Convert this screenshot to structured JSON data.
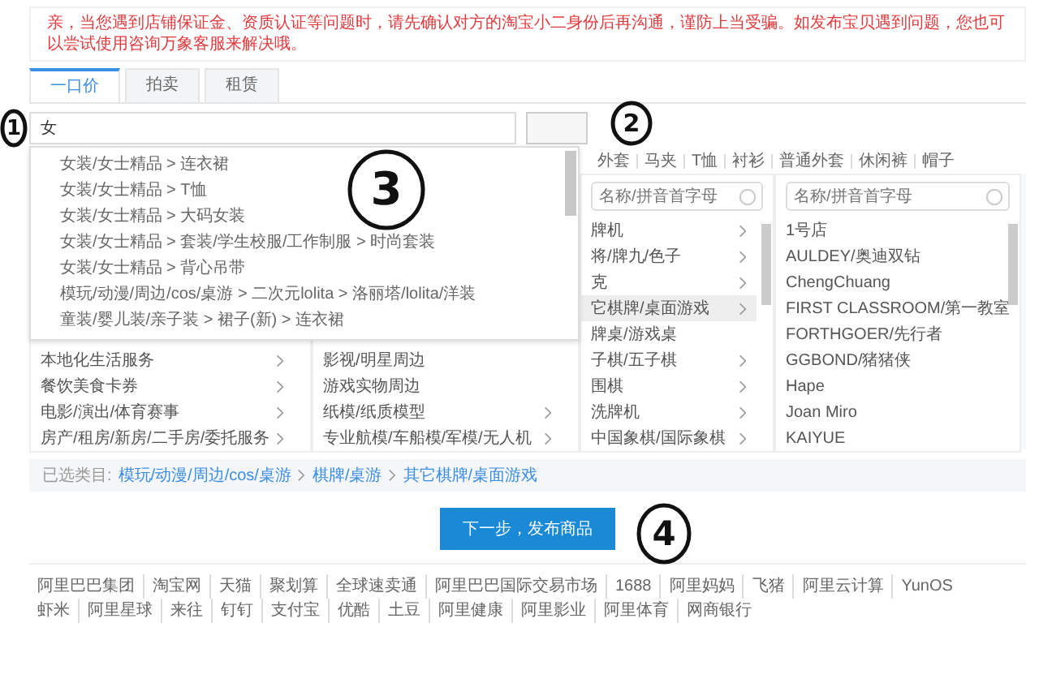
{
  "notice": "亲，当您遇到店铺保证金、资质认证等问题时，请先确认对方的淘宝小二身份后再沟通，谨防上当受骗。如发布宝贝遇到问题，您也可以尝试使用咨询万象客服来解决哦。",
  "tabs": [
    {
      "label": "一口价",
      "selected": true
    },
    {
      "label": "拍卖",
      "selected": false
    },
    {
      "label": "租赁",
      "selected": false
    }
  ],
  "search": {
    "value": "女"
  },
  "quick_links": [
    "外套",
    "马夹",
    "T恤",
    "衬衫",
    "普通外套",
    "休闲裤",
    "帽子"
  ],
  "suggestions": [
    "女装/女士精品 > 连衣裙",
    "女装/女士精品 > T恤",
    "女装/女士精品 > 大码女装",
    "女装/女士精品 > 套装/学生校服/工作制服 > 时尚套装",
    "女装/女士精品 > 背心吊带",
    "模玩/动漫/周边/cos/桌游 > 二次元lolita > 洛丽塔/lolita/洋装",
    "童装/婴儿装/亲子装 > 裙子(新) > 连衣裙"
  ],
  "columns": [
    {
      "items": [
        {
          "label": "本地化生活服务",
          "arrow": true,
          "selected": false
        },
        {
          "label": "餐饮美食卡券",
          "arrow": true,
          "selected": false
        },
        {
          "label": "电影/演出/体育赛事",
          "arrow": true,
          "selected": false
        },
        {
          "label": "房产/租房/新房/二手房/委托服务",
          "arrow": true,
          "selected": false
        }
      ]
    },
    {
      "items": [
        {
          "label": "影视/明星周边",
          "arrow": false,
          "selected": false
        },
        {
          "label": "游戏实物周边",
          "arrow": false,
          "selected": false
        },
        {
          "label": "纸模/纸质模型",
          "arrow": true,
          "selected": false
        },
        {
          "label": "专业航模/车船模/军模/无人机",
          "arrow": true,
          "selected": false
        }
      ]
    },
    {
      "placeholder": "名称/拼音首字母",
      "items": [
        {
          "label": "牌机",
          "arrow": true,
          "selected": false
        },
        {
          "label": "将/牌九/色子",
          "arrow": true,
          "selected": false
        },
        {
          "label": "克",
          "arrow": true,
          "selected": false
        },
        {
          "label": "它棋牌/桌面游戏",
          "arrow": true,
          "selected": true
        },
        {
          "label": "牌桌/游戏桌",
          "arrow": false,
          "selected": false
        },
        {
          "label": "子棋/五子棋",
          "arrow": true,
          "selected": false
        },
        {
          "label": "围棋",
          "arrow": true,
          "selected": false
        },
        {
          "label": "洗牌机",
          "arrow": true,
          "selected": false
        },
        {
          "label": "中国象棋/国际象棋",
          "arrow": true,
          "selected": false
        }
      ]
    },
    {
      "placeholder": "名称/拼音首字母",
      "items": [
        {
          "label": "1号店",
          "arrow": false,
          "selected": false
        },
        {
          "label": "AULDEY/奥迪双钻",
          "arrow": false,
          "selected": false
        },
        {
          "label": "ChengChuang",
          "arrow": false,
          "selected": false
        },
        {
          "label": "FIRST CLASSROOM/第一教室",
          "arrow": false,
          "selected": false
        },
        {
          "label": "FORTHGOER/先行者",
          "arrow": false,
          "selected": false
        },
        {
          "label": "GGBOND/猪猪侠",
          "arrow": false,
          "selected": false
        },
        {
          "label": "Hape",
          "arrow": false,
          "selected": false
        },
        {
          "label": "Joan Miro",
          "arrow": false,
          "selected": false
        },
        {
          "label": "KAIYUE",
          "arrow": false,
          "selected": false
        }
      ]
    }
  ],
  "selected_path": {
    "label": "已选类目:",
    "parts": [
      "模玩/动漫/周边/cos/桌游",
      "棋牌/桌游",
      "其它棋牌/桌面游戏"
    ]
  },
  "next_button": "下一步，发布商品",
  "footer": [
    [
      "阿里巴巴集团",
      "淘宝网",
      "天猫",
      "聚划算",
      "全球速卖通",
      "阿里巴巴国际交易市场",
      "1688",
      "阿里妈妈",
      "飞猪",
      "阿里云计算",
      "YunOS"
    ],
    [
      "虾米",
      "阿里星球",
      "来往",
      "钉钉",
      "支付宝",
      "优酷",
      "土豆",
      "阿里健康",
      "阿里影业",
      "阿里体育",
      "网商银行"
    ]
  ],
  "annotations": [
    {
      "label": "1"
    },
    {
      "label": "2"
    },
    {
      "label": "3"
    },
    {
      "label": "4"
    }
  ]
}
